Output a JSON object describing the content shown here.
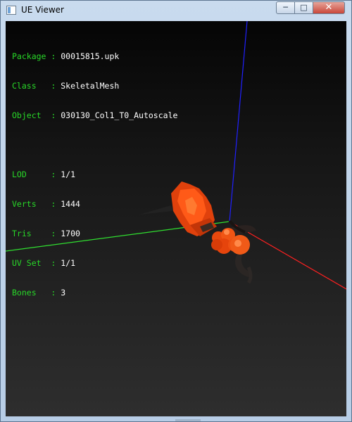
{
  "window": {
    "title": "UE Viewer",
    "controls": {
      "minimize": "─",
      "maximize": "□",
      "close": "✕"
    }
  },
  "info": {
    "package": {
      "key": "Package",
      "value": "00015815.upk"
    },
    "class": {
      "key": "Class",
      "value": "SkeletalMesh"
    },
    "object": {
      "key": "Object",
      "value": "030130_Col1_T0_Autoscale"
    },
    "lod": {
      "key": "LOD",
      "value": "1/1"
    },
    "verts": {
      "key": "Verts",
      "value": "1444"
    },
    "tris": {
      "key": "Tris",
      "value": "1700"
    },
    "uvset": {
      "key": "UV Set",
      "value": "1/1"
    },
    "bones": {
      "key": "Bones",
      "value": "3"
    }
  },
  "colors": {
    "label": "#28d828",
    "value": "#ffffff",
    "axis_x": "#ff2020",
    "axis_y": "#30e030",
    "axis_z": "#2020ff",
    "mesh": "#e04010"
  }
}
